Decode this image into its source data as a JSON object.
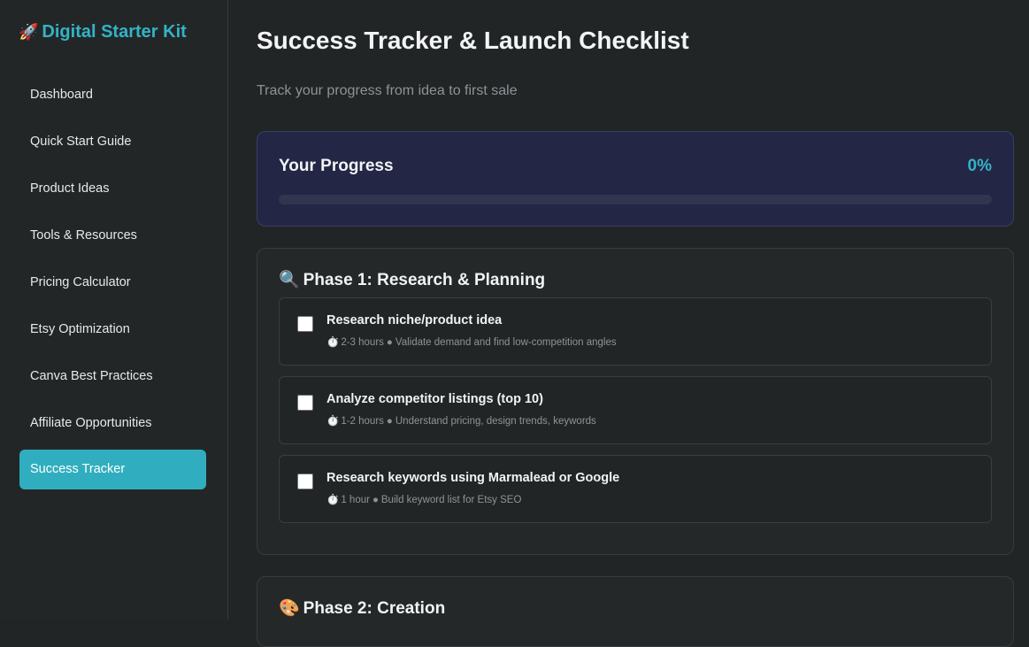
{
  "brand": {
    "icon": "rocket-icon",
    "icon_glyph": "🚀",
    "name": "Digital Starter Kit",
    "color": "#33b3c6"
  },
  "sidebar": {
    "items": [
      {
        "label": "Dashboard",
        "active": false
      },
      {
        "label": "Quick Start Guide",
        "active": false
      },
      {
        "label": "Product Ideas",
        "active": false
      },
      {
        "label": "Tools & Resources",
        "active": false
      },
      {
        "label": "Pricing Calculator",
        "active": false
      },
      {
        "label": "Etsy Optimization",
        "active": false
      },
      {
        "label": "Canva Best Practices",
        "active": false
      },
      {
        "label": "Affiliate Opportunities",
        "active": false
      },
      {
        "label": "Success Tracker",
        "active": true
      }
    ],
    "active_color": "#30aebf"
  },
  "header": {
    "title": "Success Tracker & Launch Checklist",
    "subtitle": "Track your progress from idea to first sale"
  },
  "progress": {
    "label": "Your Progress",
    "value_text": "0%",
    "fraction": 0
  },
  "phases": [
    {
      "icon": "magnifying-glass-icon",
      "icon_glyph": "🔍",
      "title": "Phase 1: Research & Planning",
      "tasks": [
        {
          "title": "Research niche/product idea",
          "timer_icon": "⏱️",
          "duration": "2-3 hours",
          "separator": "●",
          "description": "Validate demand and find low-competition angles",
          "checked": false
        },
        {
          "title": "Analyze competitor listings (top 10)",
          "timer_icon": "⏱️",
          "duration": "1-2 hours",
          "separator": "●",
          "description": "Understand pricing, design trends, keywords",
          "checked": false
        },
        {
          "title": "Research keywords using Marmalead or Google",
          "timer_icon": "⏱️",
          "duration": "1 hour",
          "separator": "●",
          "description": "Build keyword list for Etsy SEO",
          "checked": false
        }
      ]
    },
    {
      "icon": "palette-icon",
      "icon_glyph": "🎨",
      "title": "Phase 2: Creation",
      "tasks": []
    }
  ]
}
